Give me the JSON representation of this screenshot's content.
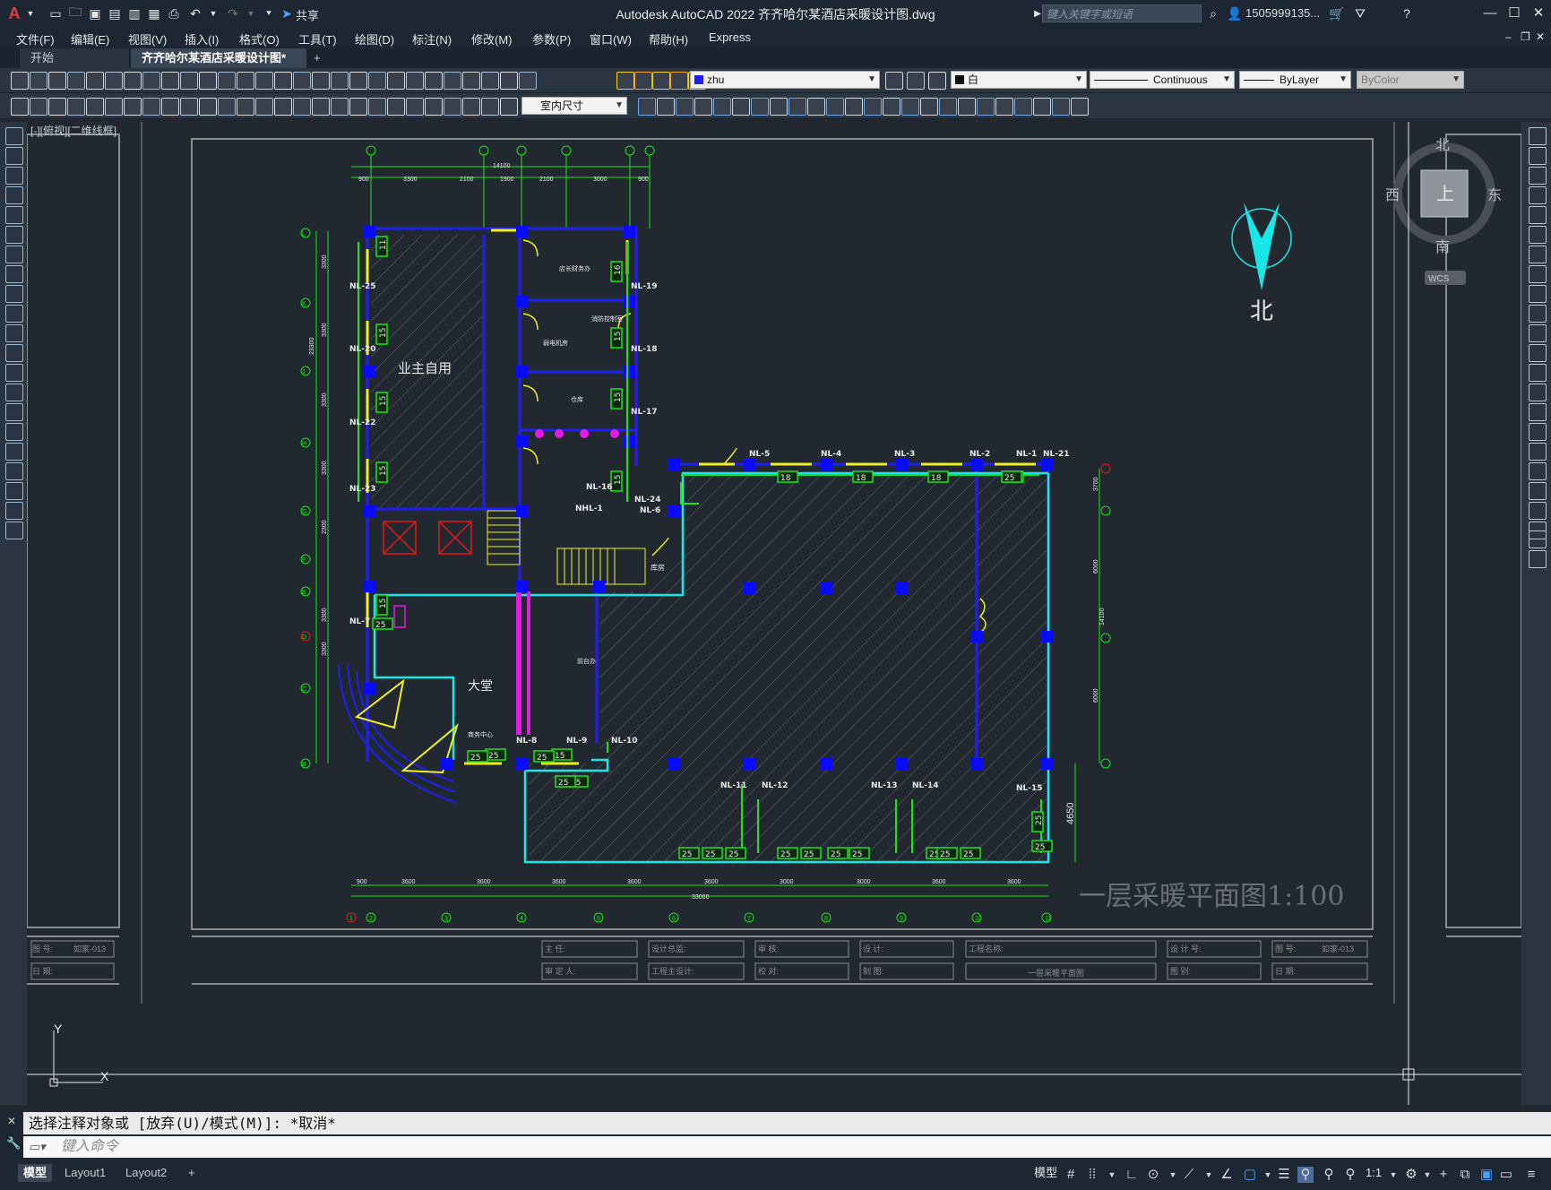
{
  "window": {
    "title": "Autodesk AutoCAD 2022    齐齐哈尔某酒店采暖设计图.dwg",
    "share_label": "共享",
    "search_placeholder": "键入关键字或短语",
    "user": "1505999135...",
    "app_logo": "A"
  },
  "menu": [
    "文件(F)",
    "编辑(E)",
    "视图(V)",
    "插入(I)",
    "格式(O)",
    "工具(T)",
    "绘图(D)",
    "标注(N)",
    "修改(M)",
    "参数(P)",
    "窗口(W)",
    "帮助(H)",
    "Express"
  ],
  "tabs": {
    "start": "开始",
    "active": "齐齐哈尔某酒店采暖设计图*",
    "add": "+"
  },
  "toolbar": {
    "layer": "zhu",
    "color": "白",
    "linetype": "Continuous",
    "lineweight": "ByLayer",
    "plotstyle": "ByColor",
    "dimstyle": "室内尺寸"
  },
  "viewport_label": "[-][俯视][二维线框]",
  "viewcube": {
    "north": "北",
    "south": "南",
    "east": "东",
    "west": "西",
    "top": "上",
    "wcs": "WCS"
  },
  "north_arrow_label": "北",
  "drawing": {
    "plan_title": "一层采暖平面图1:100",
    "room_owner": "业主自用",
    "room_lobby": "大堂",
    "room_small_1": "店长财务办",
    "room_small_2": "消防控制室",
    "room_small_3": "弱电机房",
    "room_small_4": "仓库",
    "room_small_5": "前台办",
    "room_small_6": "商务中心",
    "room_small_7": "库房",
    "dim_top_total": "14100",
    "dim_bottom_total": "33000",
    "dim_left_total": "23300",
    "dim_right_1": "4650",
    "dim_right_2": "14100",
    "dims_top": [
      "900",
      "3300",
      "2100",
      "1900",
      "2100",
      "3000",
      "900"
    ],
    "dims_bottom": [
      "900",
      "3600",
      "3600",
      "3600",
      "3600",
      "3600",
      "3000",
      "3000",
      "3600",
      "3600"
    ],
    "dims_left": [
      "3300",
      "3300",
      "3300",
      "3300",
      "2300",
      "3300",
      "3300"
    ],
    "dims_right": [
      "3700",
      "6000",
      "6000"
    ],
    "axis_top": [
      "1",
      "2",
      "3",
      "4",
      "5",
      "6"
    ],
    "axis_left": [
      "L",
      "K",
      "J",
      "H",
      "G",
      "F",
      "E",
      "D",
      "C",
      "B",
      "A"
    ],
    "axis_bottom": [
      "1",
      "2",
      "3",
      "4",
      "5",
      "6",
      "7",
      "8",
      "9",
      "10",
      "11",
      "12"
    ],
    "axis_right": [
      "F",
      "E",
      "D",
      "C",
      "A"
    ],
    "radiators": [
      {
        "id": "NL-25",
        "n": "11"
      },
      {
        "id": "NL-20",
        "n": "15"
      },
      {
        "id": "NL-22",
        "n": "15"
      },
      {
        "id": "NL-23",
        "n": "15"
      },
      {
        "id": "NL-19",
        "n": "16"
      },
      {
        "id": "NL-18",
        "n": "15"
      },
      {
        "id": "NL-17",
        "n": "15"
      },
      {
        "id": "NL-16",
        "n": "15"
      },
      {
        "id": "NL-24",
        "n": "15"
      },
      {
        "id": "NL-5",
        "n": "18"
      },
      {
        "id": "NL-4",
        "n": "18"
      },
      {
        "id": "NL-3",
        "n": "18"
      },
      {
        "id": "NL-2",
        "n": "25"
      },
      {
        "id": "NL-1",
        "n": "25"
      },
      {
        "id": "NL-7",
        "n": "25"
      },
      {
        "id": "NL-8",
        "n": "25"
      },
      {
        "id": "NL-9",
        "n": "15"
      },
      {
        "id": "NL-10",
        "n": "25"
      },
      {
        "id": "NL-11",
        "n": "25"
      },
      {
        "id": "NL-12",
        "n": "25"
      },
      {
        "id": "NL-13",
        "n": "25"
      },
      {
        "id": "NL-14",
        "n": "25"
      },
      {
        "id": "NL-15",
        "n": "25"
      },
      {
        "id": "NL-21",
        "n": ""
      },
      {
        "id": "NL-6",
        "n": ""
      },
      {
        "id": "NHL-1",
        "n": ""
      }
    ]
  },
  "titleblock": {
    "left_no_label": "图    号:",
    "left_no_value": "如家-013",
    "left_date_label": "日    期:",
    "director": "主 任:",
    "reviewer": "审 定 人:",
    "design_lead": "设计总监:",
    "eng_design": "工程主设计:",
    "audit": "审  核:",
    "proof": "校  对:",
    "designer": "设    计:",
    "drafter": "制    图:",
    "project_label": "工程名称:",
    "drawing_name": "一层采暖平面图",
    "design_no_label": "设 计 号:",
    "scale_label": "图    别:",
    "right_no_label": "图    号:",
    "right_no_value": "如家-013",
    "right_date_label": "日    期:"
  },
  "ucs": {
    "y": "Y",
    "x": "X"
  },
  "command": {
    "history": "选择注释对象或 [放弃(U)/模式(M)]: *取消*",
    "placeholder": "键入命令"
  },
  "status": {
    "tabs": [
      "模型",
      "Layout1",
      "Layout2"
    ],
    "add": "+",
    "model_btn": "模型",
    "scale": "1:1"
  },
  "colors": {
    "wall": "#1f1ff0",
    "column": "#0a0aff",
    "green": "#19e619",
    "cyan": "#19e6e6",
    "yellow": "#f0f019",
    "magenta": "#e619e6",
    "red": "#e61919",
    "white": "#e8e8e8",
    "frame": "#8c8c8c"
  }
}
